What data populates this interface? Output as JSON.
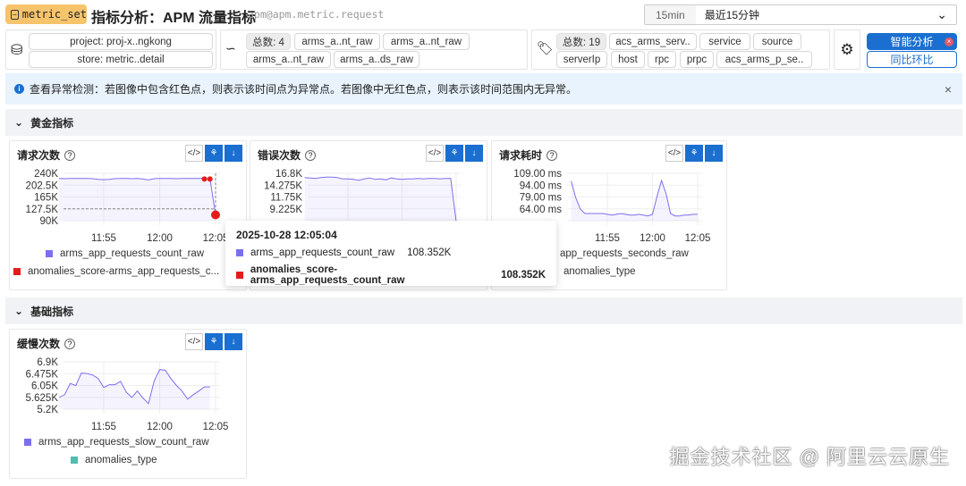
{
  "header": {
    "badge": "metric_set",
    "title": "指标分析：APM 流量指标",
    "subtitle": "apm@apm.metric.request"
  },
  "time_select": {
    "short": "15min",
    "label": "最近15分钟"
  },
  "store": {
    "project": "project: proj-x..ngkong",
    "store": "store: metric..detail"
  },
  "metrics": {
    "total": "总数: 4",
    "items": [
      "arms_a..nt_raw",
      "arms_a..nt_raw",
      "arms_a..nt_raw",
      "arms_a..ds_raw"
    ]
  },
  "tags": {
    "total": "总数: 19",
    "items": [
      "acs_arms_serv..",
      "service",
      "source",
      "serverIp",
      "host",
      "rpc",
      "prpc",
      "acs_arms_p_se.."
    ]
  },
  "buttons": {
    "smart": "智能分析",
    "compare": "同比环比"
  },
  "alert": {
    "text": "查看异常检测：若图像中包含红色点，则表示该时间点为异常点。若图像中无红色点，则表示该时间范围内无异常。"
  },
  "sections": [
    {
      "title": "黄金指标"
    },
    {
      "title": "基础指标"
    }
  ],
  "colors": {
    "series": "#7b6ff0",
    "anomaly": "#e51c1c",
    "type": "#4dbfae",
    "primary": "#1a6fd0"
  },
  "chart_data": [
    {
      "type": "line",
      "title": "请求次数",
      "unit": "K",
      "ylim": [
        90,
        240
      ],
      "yticks": [
        "240K",
        "202.5K",
        "165K",
        "127.5K",
        "90K"
      ],
      "xticks": [
        "11:55",
        "12:00",
        "12:05"
      ],
      "xtick_min": [
        5,
        10,
        15
      ],
      "t_start_min": 1,
      "step_min": 0.5,
      "values": [
        224,
        223,
        224,
        224,
        224,
        224,
        223,
        221,
        220,
        221,
        223,
        224,
        224,
        223,
        224,
        222,
        219,
        223,
        224,
        224,
        224,
        223,
        224,
        224,
        224,
        224,
        224,
        223,
        108.352
      ],
      "anomalies": [
        {
          "t": 14,
          "v": 222
        },
        {
          "t": 14.5,
          "v": 222
        },
        {
          "t": 15,
          "v": 108.352
        }
      ],
      "legend": [
        "arms_app_requests_count_raw",
        "anomalies_score-arms_app_requests_c..."
      ]
    },
    {
      "type": "line",
      "title": "错误次数",
      "unit": "K",
      "ylim": [
        6.7,
        16.8
      ],
      "yticks": [
        "16.8K",
        "14.275K",
        "11.75K",
        "9.225K"
      ],
      "xticks": [],
      "xtick_min": [
        5,
        10,
        15
      ],
      "t_start_min": 1,
      "step_min": 0.5,
      "values": [
        15.9,
        15.8,
        15.7,
        15.9,
        16.0,
        16.0,
        15.9,
        15.6,
        15.6,
        15.5,
        15.3,
        15.6,
        15.8,
        15.5,
        15.6,
        15.4,
        15.8,
        15.6,
        15.5,
        15.6,
        15.6,
        15.7,
        15.6,
        15.7,
        15.7,
        15.6,
        15.7,
        15.7,
        6.5
      ],
      "legend": []
    },
    {
      "type": "line",
      "title": "请求耗时",
      "unit": "ms",
      "ylim": [
        49,
        109
      ],
      "yticks": [
        "109.00 ms",
        "94.00 ms",
        "79.00 ms",
        "64.00 ms"
      ],
      "xticks": [
        "11:55",
        "12:00",
        "12:05"
      ],
      "xtick_min": [
        5,
        10,
        15
      ],
      "t_start_min": 1,
      "step_min": 0.5,
      "values": [
        99,
        78,
        64,
        58,
        58,
        58,
        58,
        58,
        57,
        56,
        57,
        58,
        57,
        56,
        56,
        57,
        56,
        55,
        57,
        80,
        100,
        83,
        58,
        55,
        55,
        56,
        56,
        57,
        57
      ],
      "legend": [
        "app_requests_seconds_raw",
        "anomalies_type"
      ]
    },
    {
      "type": "line",
      "title": "缓慢次数",
      "unit": "K",
      "ylim": [
        5.2,
        6.9
      ],
      "yticks": [
        "6.9K",
        "6.475K",
        "6.05K",
        "5.625K",
        "5.2K"
      ],
      "xticks": [
        "11:55",
        "12:00",
        "12:05"
      ],
      "xtick_min": [
        5,
        10,
        15
      ],
      "t_start_min": 1,
      "step_min": 0.5,
      "values": [
        5.62,
        5.72,
        6.12,
        6.05,
        6.5,
        6.48,
        6.43,
        6.3,
        5.98,
        6.08,
        6.08,
        6.2,
        5.82,
        5.62,
        5.85,
        5.6,
        5.4,
        6.2,
        6.62,
        6.6,
        6.3,
        6.05,
        5.85,
        5.56,
        5.72,
        5.85,
        6.0,
        6.0
      ],
      "legend": [
        "arms_app_requests_slow_count_raw",
        "anomalies_type"
      ]
    }
  ],
  "tooltip": {
    "time": "2025-10-28 12:05:04",
    "rows": [
      {
        "name": "arms_app_requests_count_raw",
        "value": "108.352K"
      },
      {
        "name": "anomalies_score-arms_app_requests_count_raw",
        "value": "108.352K"
      }
    ]
  },
  "watermark": "掘金技术社区 @ 阿里云云原生"
}
